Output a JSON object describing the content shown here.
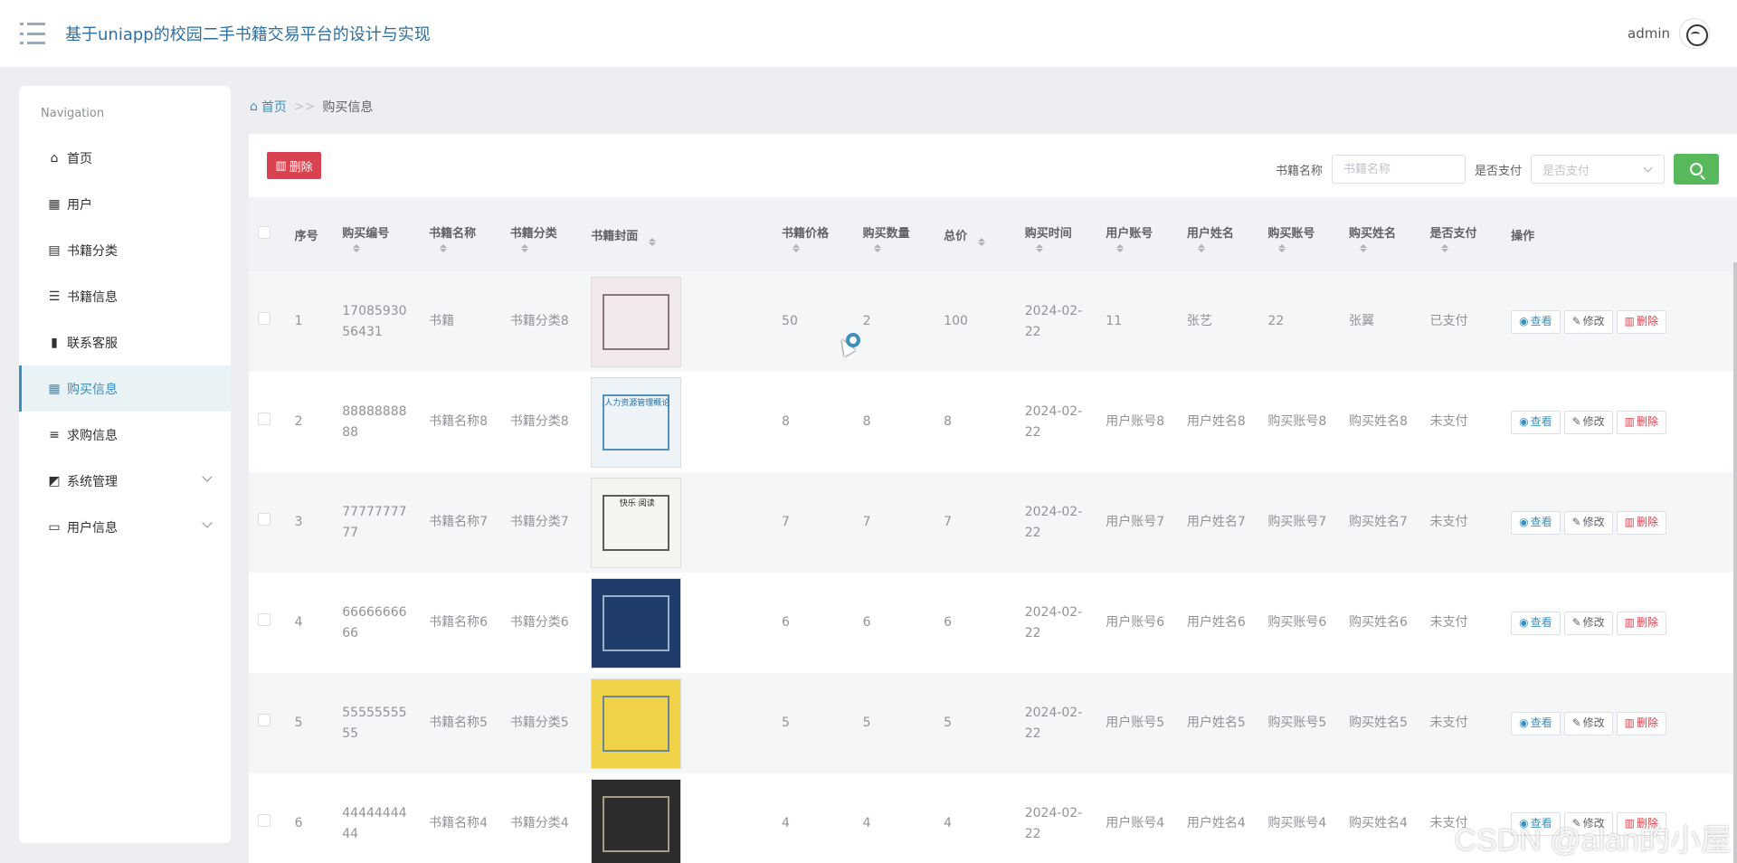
{
  "header": {
    "title": "基于uniapp的校园二手书籍交易平台的设计与实现",
    "user": "admin"
  },
  "sidebar": {
    "heading": "Navigation",
    "items": [
      {
        "label": "首页",
        "icon": "home-icon"
      },
      {
        "label": "用户",
        "icon": "grid-icon"
      },
      {
        "label": "书籍分类",
        "icon": "clipboard-icon"
      },
      {
        "label": "书籍信息",
        "icon": "list-icon"
      },
      {
        "label": "联系客服",
        "icon": "bar-chart-icon"
      },
      {
        "label": "购买信息",
        "icon": "grid-icon",
        "active": true
      },
      {
        "label": "求购信息",
        "icon": "sliders-icon"
      },
      {
        "label": "系统管理",
        "icon": "line-chart-icon",
        "expandable": true
      },
      {
        "label": "用户信息",
        "icon": "card-icon",
        "expandable": true
      }
    ]
  },
  "breadcrumb": {
    "home": "首页",
    "sep": ">>",
    "current": "购买信息"
  },
  "toolbar": {
    "delete_label": "删除",
    "book_name_label": "书籍名称",
    "book_name_placeholder": "书籍名称",
    "paid_label": "是否支付",
    "paid_placeholder": "是否支付"
  },
  "table": {
    "headers": [
      "序号",
      "购买编号",
      "书籍名称",
      "书籍分类",
      "书籍封面",
      "书籍价格",
      "购买数量",
      "总价",
      "购买时间",
      "用户账号",
      "用户姓名",
      "购买账号",
      "购买姓名",
      "是否支付",
      "操作"
    ],
    "actions": {
      "view": "查看",
      "edit": "修改",
      "delete": "删除"
    },
    "rows": [
      {
        "idx": "1",
        "no_a": "17085930",
        "no_b": "56431",
        "name": "书籍",
        "category": "书籍分类8",
        "price": "50",
        "qty": "2",
        "total": "100",
        "date_a": "2024-02-",
        "date_b": "22",
        "account": "11",
        "username": "张艺",
        "buy_account": "22",
        "buy_name": "张翼",
        "paid": "已支付"
      },
      {
        "idx": "2",
        "no_a": "88888888",
        "no_b": "88",
        "name": "书籍名称8",
        "category": "书籍分类8",
        "price": "8",
        "qty": "8",
        "total": "8",
        "date_a": "2024-02-",
        "date_b": "22",
        "account": "用户账号8",
        "username": "用户姓名8",
        "buy_account": "购买账号8",
        "buy_name": "购买姓名8",
        "paid": "未支付"
      },
      {
        "idx": "3",
        "no_a": "77777777",
        "no_b": "77",
        "name": "书籍名称7",
        "category": "书籍分类7",
        "price": "7",
        "qty": "7",
        "total": "7",
        "date_a": "2024-02-",
        "date_b": "22",
        "account": "用户账号7",
        "username": "用户姓名7",
        "buy_account": "购买账号7",
        "buy_name": "购买姓名7",
        "paid": "未支付"
      },
      {
        "idx": "4",
        "no_a": "66666666",
        "no_b": "66",
        "name": "书籍名称6",
        "category": "书籍分类6",
        "price": "6",
        "qty": "6",
        "total": "6",
        "date_a": "2024-02-",
        "date_b": "22",
        "account": "用户账号6",
        "username": "用户姓名6",
        "buy_account": "购买账号6",
        "buy_name": "购买姓名6",
        "paid": "未支付"
      },
      {
        "idx": "5",
        "no_a": "55555555",
        "no_b": "55",
        "name": "书籍名称5",
        "category": "书籍分类5",
        "price": "5",
        "qty": "5",
        "total": "5",
        "date_a": "2024-02-",
        "date_b": "22",
        "account": "用户账号5",
        "username": "用户姓名5",
        "buy_account": "购买账号5",
        "buy_name": "购买姓名5",
        "paid": "未支付"
      },
      {
        "idx": "6",
        "no_a": "44444444",
        "no_b": "44",
        "name": "书籍名称4",
        "category": "书籍分类4",
        "price": "4",
        "qty": "4",
        "total": "4",
        "date_a": "2024-02-",
        "date_b": "22",
        "account": "用户账号4",
        "username": "用户姓名4",
        "buy_account": "购买账号4",
        "buy_name": "购买姓名4",
        "paid": "未支付"
      }
    ]
  },
  "covers": [
    {
      "bg": "#f2e9ef",
      "accent": "#6b4a5a",
      "text": ""
    },
    {
      "bg": "#eef3f8",
      "accent": "#1f6fa8",
      "text": "人力资源管理概论"
    },
    {
      "bg": "#f4f4f0",
      "accent": "#2a2a2a",
      "text": "快乐 阅读"
    },
    {
      "bg": "#1f3c6a",
      "accent": "#c7d6ea",
      "text": ""
    },
    {
      "bg": "#f1d34a",
      "accent": "#3b6fb0",
      "text": ""
    },
    {
      "bg": "#2d2d2d",
      "accent": "#d0c4a0",
      "text": ""
    }
  ],
  "watermark": "CSDN @alan的小屋"
}
